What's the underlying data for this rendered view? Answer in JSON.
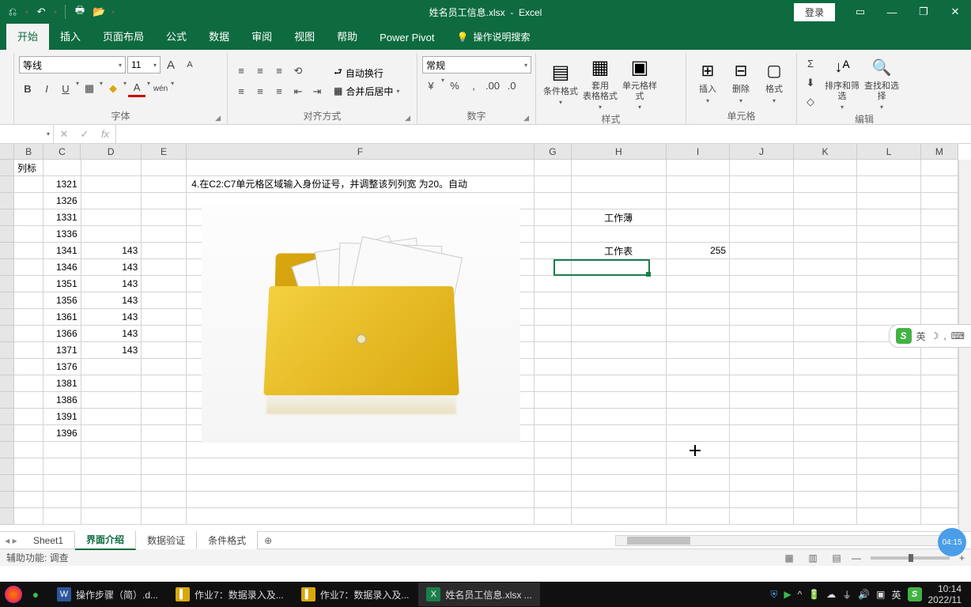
{
  "title": {
    "filename": "姓名员工信息.xlsx",
    "app": "Excel",
    "login": "登录"
  },
  "tabs": {
    "start": "开始",
    "insert": "插入",
    "layout": "页面布局",
    "formula": "公式",
    "data": "数据",
    "review": "审阅",
    "view": "视图",
    "help": "帮助",
    "pivot": "Power Pivot",
    "tellme": "操作说明搜索"
  },
  "ribbon": {
    "font": {
      "name": "等线",
      "size": "11",
      "group": "字体"
    },
    "align": {
      "wrap": "自动换行",
      "merge": "合并后居中",
      "group": "对齐方式"
    },
    "number": {
      "format": "常规",
      "pct": "%",
      "comma": ",",
      "group": "数字"
    },
    "styles": {
      "cond": "条件格式",
      "table": "套用\n表格格式",
      "cell": "单元格样式",
      "group": "样式"
    },
    "cells": {
      "insert": "插入",
      "delete": "删除",
      "format": "格式",
      "group": "单元格"
    },
    "editing": {
      "sort": "排序和筛选",
      "find": "查找和选择",
      "group": "编辑"
    }
  },
  "formula_bar": {
    "name": "",
    "fx": "fx"
  },
  "columns": [
    "B",
    "C",
    "D",
    "E",
    "F",
    "G",
    "H",
    "I",
    "J",
    "K",
    "L",
    "M"
  ],
  "col_label": "列标",
  "cellsC": [
    "1321",
    "1326",
    "1331",
    "1336",
    "1341",
    "1346",
    "1351",
    "1356",
    "1361",
    "1366",
    "1371",
    "1376",
    "1381",
    "1386",
    "1391",
    "1396"
  ],
  "cellsD": [
    "",
    "",
    "",
    "",
    "143",
    "143",
    "143",
    "143",
    "143",
    "143",
    "143",
    "",
    "",
    "",
    "",
    ""
  ],
  "f_text": "4.在C2:C7单元格区域输入身份证号，并调整该列列宽 为20。自动",
  "h_workbook": "工作薄",
  "h_worksheet": "工作表",
  "i_val": "255",
  "sheets": {
    "s1": "Sheet1",
    "s2": "界面介绍",
    "s3": "数据验证",
    "s4": "条件格式"
  },
  "status": {
    "left": "辅助功能: 调查"
  },
  "ime": {
    "lang": "英"
  },
  "taskbar": {
    "app1": "操作步骤（简）.d...",
    "app2": "作业7：数据录入及...",
    "app3": "作业7：数据录入及...",
    "app4": "姓名员工信息.xlsx ...",
    "time": "10:14",
    "date": "2022/11",
    "lang": "英"
  },
  "timer": "04:15"
}
